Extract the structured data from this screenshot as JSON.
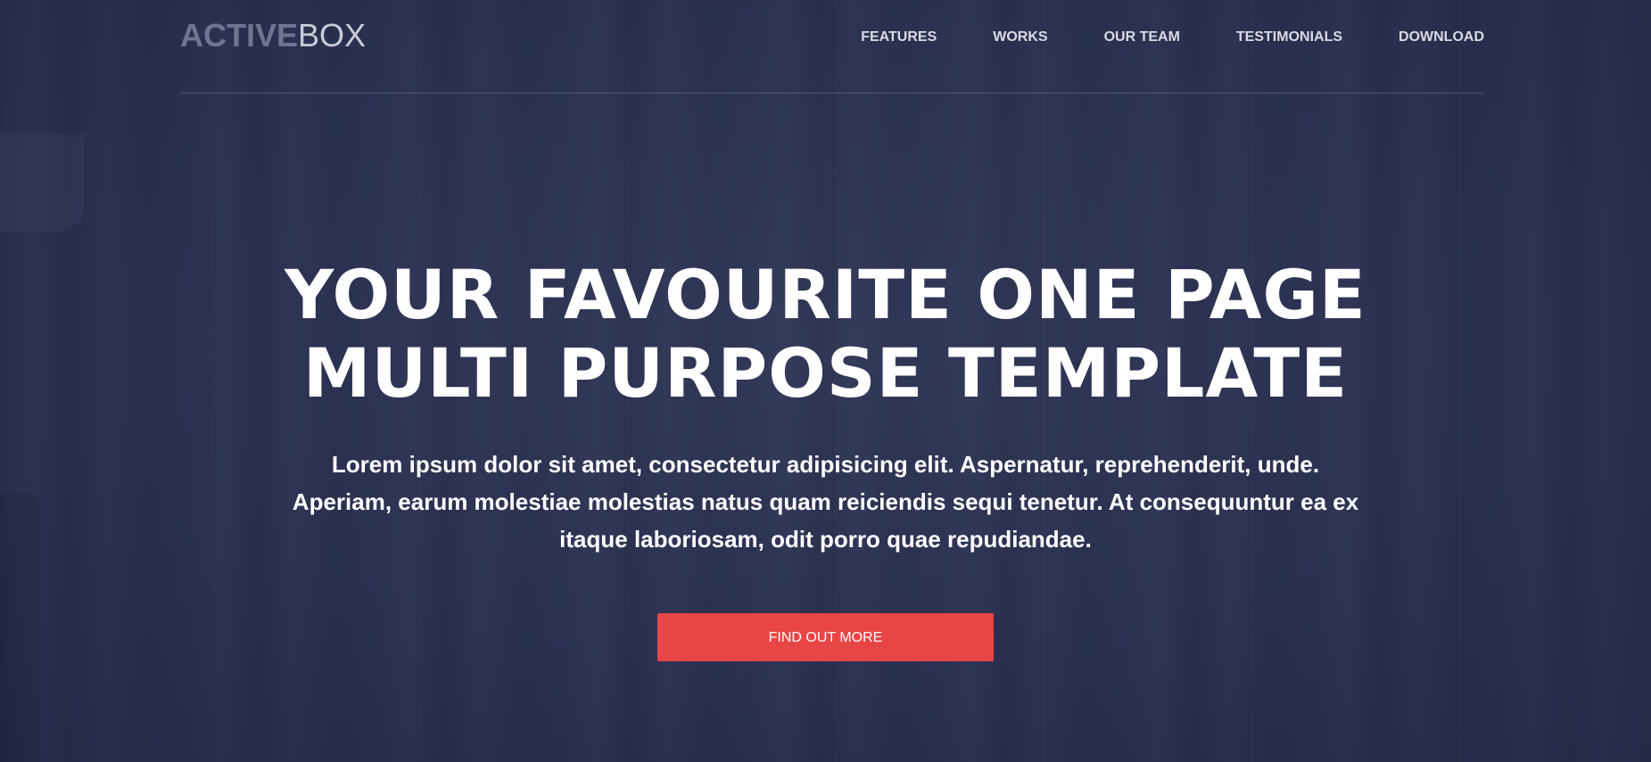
{
  "brand": {
    "logo_part1": "ACTIVE",
    "logo_part2": "BOX"
  },
  "nav": {
    "items": [
      {
        "label": "FEATURES"
      },
      {
        "label": "WORKS"
      },
      {
        "label": "OUR TEAM"
      },
      {
        "label": "TESTIMONIALS"
      },
      {
        "label": "DOWNLOAD"
      }
    ]
  },
  "hero": {
    "headline_line1": "YOUR FAVOURITE ONE PAGE",
    "headline_line2": "MULTI PURPOSE TEMPLATE",
    "description": "Lorem ipsum dolor sit amet, consectetur adipisicing elit. Aspernatur, reprehenderit, unde. Aperiam, earum molestiae molestias natus quam reiciendis sequi tenetur. At consequuntur ea ex itaque laboriosam, odit porro quae repudiandae.",
    "cta_label": "FIND OUT MORE"
  },
  "colors": {
    "background": "#2b3050",
    "accent": "#e84545",
    "text": "#ffffff"
  }
}
